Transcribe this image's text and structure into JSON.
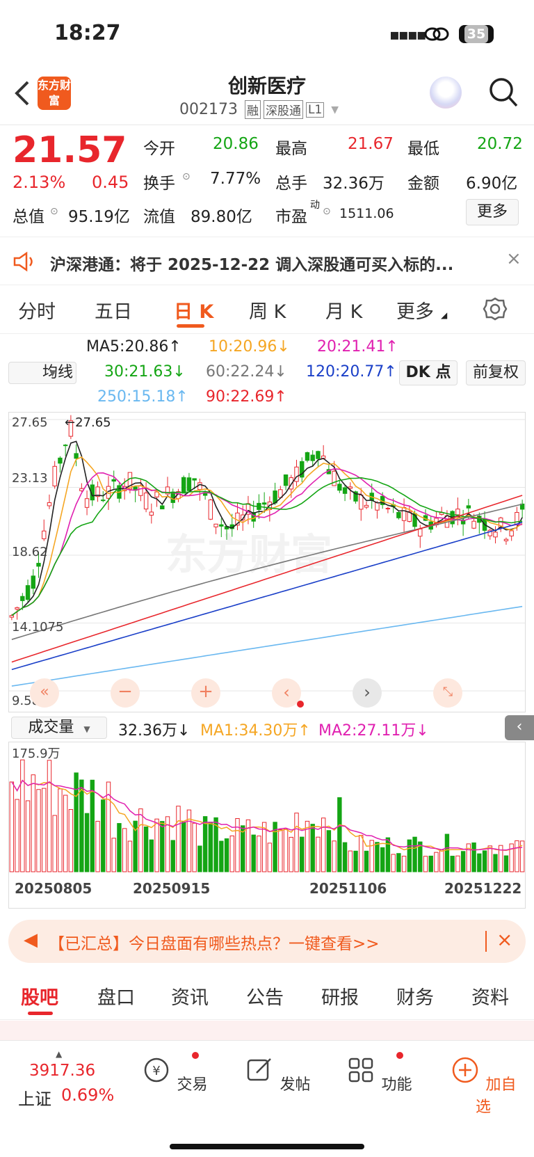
{
  "status": {
    "time": "18:27",
    "battery": "35"
  },
  "header": {
    "logo": "东方财富",
    "title": "创新医疗",
    "code": "002173",
    "tags": [
      "融",
      "深股通",
      "L1"
    ]
  },
  "quote": {
    "price": "21.57",
    "change_pct": "2.13%",
    "change_abs": "0.45",
    "open_label": "今开",
    "open": "20.86",
    "high_label": "最高",
    "high": "21.67",
    "low_label": "最低",
    "low": "20.72",
    "turnover_label": "换手",
    "turnover": "7.77%",
    "volume_label": "总手",
    "volume": "32.36万",
    "amount_label": "金额",
    "amount": "6.90亿",
    "mktcap_label": "总值",
    "mktcap": "95.19亿",
    "float_label": "流值",
    "float": "89.80亿",
    "pe_label": "市盈",
    "pe_sup": "动",
    "pe": "1511.06",
    "more": "更多"
  },
  "notice": {
    "text": "沪深港通：将于 2025-12-22 调入深股通可买入标的..."
  },
  "tabs": [
    "分时",
    "五日",
    "日 K",
    "周 K",
    "月 K",
    "更多"
  ],
  "active_tab": "日 K",
  "ma": {
    "select": "均线",
    "ma5": "MA5:20.86↑",
    "ma10": "10:20.96↓",
    "ma20": "20:21.41↑",
    "ma30": "30:21.63↓",
    "ma60": "60:22.24↓",
    "ma120": "120:20.77↑",
    "ma250": "250:15.18↑",
    "ma90": "90:22.69↑",
    "dk_btn": "DK 点",
    "fq_btn": "前复权",
    "colors": {
      "ma5": "#222222",
      "ma10": "#f5a623",
      "ma20": "#e020b0",
      "ma30": "#14a514",
      "ma60": "#777777",
      "ma120": "#1a3fc8",
      "ma250": "#6ab8f0",
      "ma90": "#e8262c"
    }
  },
  "chart_labels": {
    "y_top": "27.65",
    "high_marker": "←27.65",
    "y_2": "23.13",
    "y_3": "18.62",
    "y_4": "14.1075",
    "y_bottom": "9.58"
  },
  "chart_data": {
    "type": "candlestick",
    "y_range": [
      9.58,
      27.65
    ],
    "y_ticks": [
      "27.65",
      "23.13",
      "18.62",
      "14.1075",
      "9.58"
    ],
    "x_labels": [
      "20250805",
      "20250915",
      "20251106",
      "20251222"
    ],
    "volume_max_label": "175.9万",
    "volume_labels": {
      "select": "成交量",
      "vol": "32.36万↓",
      "ma1": "MA1:34.30万↑",
      "ma2": "MA2:27.11万↓"
    }
  },
  "promo": {
    "text": "【已汇总】今日盘面有哪些热点？一键查看>>"
  },
  "bottom_tabs": [
    "股吧",
    "盘口",
    "资讯",
    "公告",
    "研报",
    "财务",
    "资料"
  ],
  "active_bottom_tab": "股吧",
  "index": {
    "value": "3917.36",
    "name": "上证",
    "pct": "0.69%"
  },
  "nav": [
    "交易",
    "发帖",
    "功能",
    "加自选"
  ]
}
